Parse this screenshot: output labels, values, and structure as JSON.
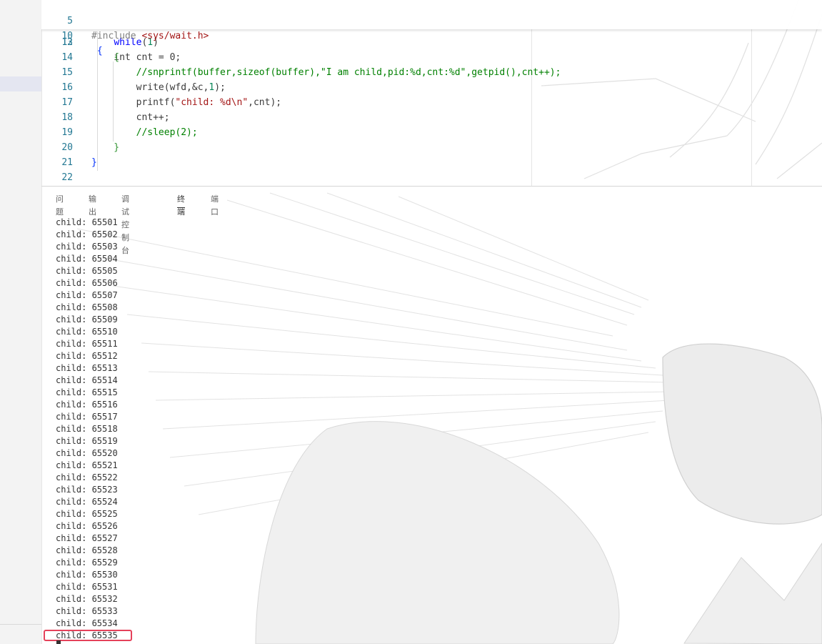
{
  "editor": {
    "sticky": [
      {
        "num": "5",
        "parts": [
          {
            "t": "#include ",
            "c": "dir"
          },
          {
            "t": "<sys/wait.h>",
            "c": "inc"
          }
        ]
      },
      {
        "num": "10",
        "parts": [
          {
            "t": " {",
            "c": "brace1"
          }
        ]
      }
    ],
    "partial_line": {
      "num": "12",
      "text": "    int cnt = 0;"
    },
    "lines": [
      {
        "num": "13",
        "parts": [
          {
            "t": "    ",
            "c": ""
          },
          {
            "t": "while",
            "c": "kw"
          },
          {
            "t": "(",
            "c": ""
          },
          {
            "t": "1",
            "c": "num"
          },
          {
            "t": ")",
            "c": ""
          }
        ]
      },
      {
        "num": "14",
        "parts": [
          {
            "t": "    {",
            "c": "brace2"
          }
        ]
      },
      {
        "num": "15",
        "parts": [
          {
            "t": "        //snprintf(buffer,sizeof(buffer),\"I am child,pid:%d,cnt:%d\",getpid(),cnt++);",
            "c": "cm"
          }
        ]
      },
      {
        "num": "16",
        "parts": [
          {
            "t": "        write(wfd,&c,",
            "c": ""
          },
          {
            "t": "1",
            "c": "num"
          },
          {
            "t": ");",
            "c": ""
          }
        ]
      },
      {
        "num": "17",
        "parts": [
          {
            "t": "        printf(",
            "c": ""
          },
          {
            "t": "\"child: %d\\n\"",
            "c": "str"
          },
          {
            "t": ",cnt);",
            "c": ""
          }
        ]
      },
      {
        "num": "18",
        "parts": [
          {
            "t": "        cnt++;",
            "c": ""
          }
        ]
      },
      {
        "num": "19",
        "parts": [
          {
            "t": "        //sleep(2);",
            "c": "cm"
          }
        ]
      },
      {
        "num": "20",
        "parts": [
          {
            "t": "    }",
            "c": "brace2"
          }
        ]
      },
      {
        "num": "21",
        "parts": [
          {
            "t": "}",
            "c": "brace1"
          }
        ]
      },
      {
        "num": "22",
        "parts": []
      }
    ]
  },
  "panel": {
    "tabs": [
      {
        "label": "问题",
        "active": false
      },
      {
        "label": "输出",
        "active": false
      },
      {
        "label": "调试控制台",
        "active": false
      },
      {
        "label": "终端",
        "active": true
      },
      {
        "label": "端口",
        "active": false
      }
    ]
  },
  "terminal": {
    "lines": [
      "child: 65501",
      "child: 65502",
      "child: 65503",
      "child: 65504",
      "child: 65505",
      "child: 65506",
      "child: 65507",
      "child: 65508",
      "child: 65509",
      "child: 65510",
      "child: 65511",
      "child: 65512",
      "child: 65513",
      "child: 65514",
      "child: 65515",
      "child: 65516",
      "child: 65517",
      "child: 65518",
      "child: 65519",
      "child: 65520",
      "child: 65521",
      "child: 65522",
      "child: 65523",
      "child: 65524",
      "child: 65525",
      "child: 65526",
      "child: 65527",
      "child: 65528",
      "child: 65529",
      "child: 65530",
      "child: 65531",
      "child: 65532",
      "child: 65533",
      "child: 65534",
      "child: 65535"
    ],
    "highlight_color": "#e5415a"
  },
  "colors": {
    "line_number": "#237893",
    "keyword": "#0000ff",
    "string": "#a31515",
    "comment": "#008000"
  }
}
